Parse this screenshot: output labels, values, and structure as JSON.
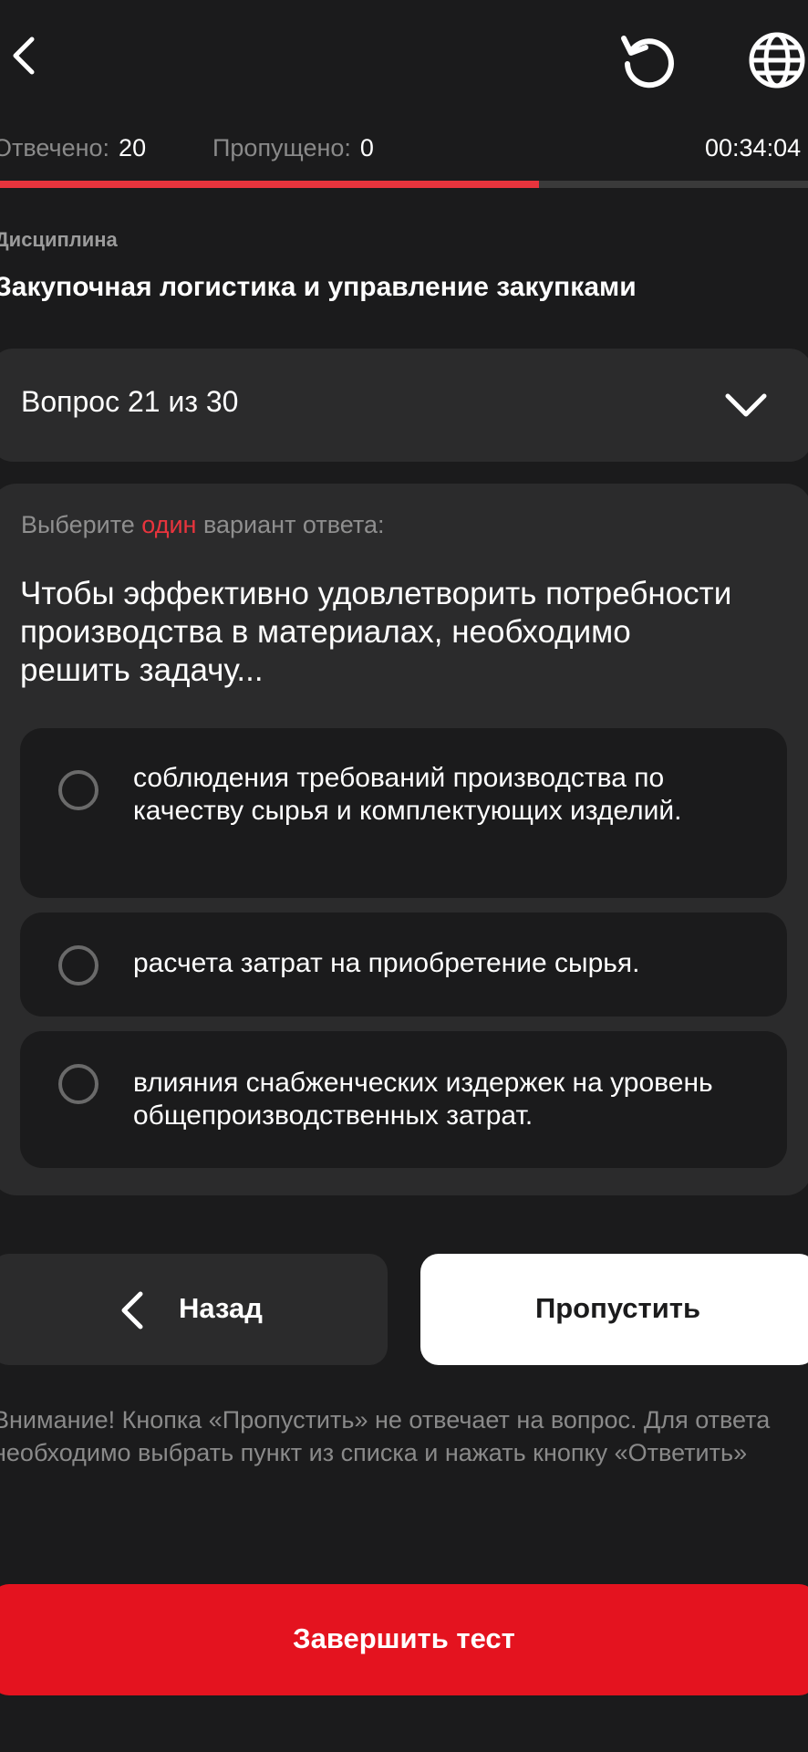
{
  "stats": {
    "answered_label": "Отвечено:",
    "answered_value": "20",
    "skipped_label": "Пропущено:",
    "skipped_value": "0",
    "timer": "00:34:04"
  },
  "progress": {
    "fraction": 0.667,
    "fill_color": "#e8343d"
  },
  "discipline": {
    "label": "Дисциплина",
    "name": "Закупочная логистика и управление закупками"
  },
  "question_selector": {
    "label": "Вопрос 21 из 30"
  },
  "question": {
    "instruction_prefix": "Выберите",
    "instruction_accent": "один",
    "instruction_suffix": "вариант ответа:",
    "text": "Чтобы эффективно удовлетворить потребности производства в материалах, необходимо решить задачу...",
    "options": [
      {
        "text": "соблюдения требований производства по качеству сырья и комплектующих изделий."
      },
      {
        "text": "расчета затрат на приобретение сырья."
      },
      {
        "text": "влияния снабженческих издержек на уровень общепроизводственных затрат."
      }
    ]
  },
  "nav": {
    "back_label": "Назад",
    "skip_label": "Пропустить"
  },
  "warning": "Внимание! Кнопка «Пропустить» не отвечает на вопрос. Для ответа необходимо выбрать пункт из списка и нажать кнопку «Ответить»",
  "finish": {
    "label": "Завершить тест"
  },
  "icons": {
    "back": "chevron-left-icon",
    "reload": "reload-icon",
    "language": "globe-icon",
    "expand": "chevron-down-icon"
  },
  "colors": {
    "background": "#1b1b1c",
    "card": "#2b2b2c",
    "accent": "#e8343d",
    "finish_button": "#e4131f"
  }
}
